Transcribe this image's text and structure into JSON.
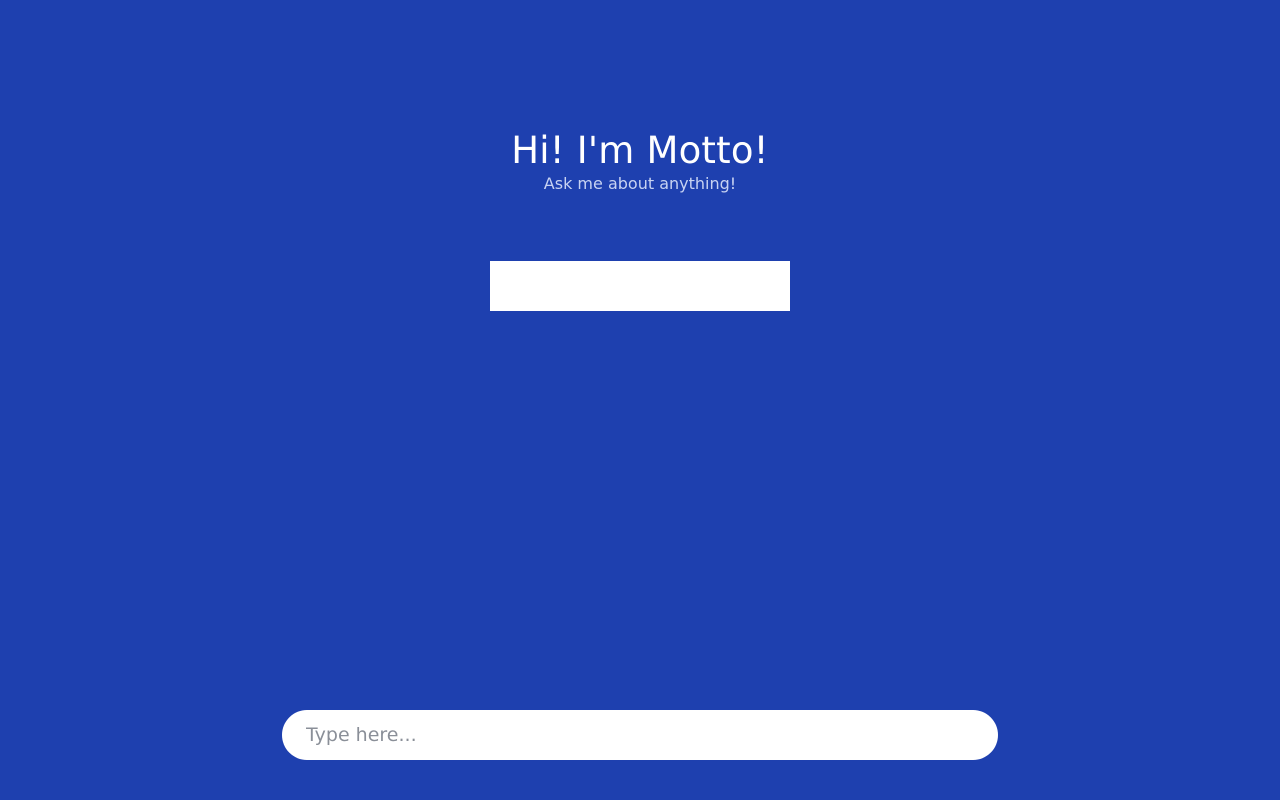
{
  "hero": {
    "title": "Hi! I'm Motto!",
    "subtitle": "Ask me about anything!"
  },
  "chat_input": {
    "value": "",
    "placeholder": "Type here..."
  },
  "colors": {
    "background": "#1e40af",
    "title_text": "#ffffff",
    "subtitle_text": "#c7d2f2",
    "input_background": "#ffffff",
    "placeholder_text": "#8a8f98"
  }
}
